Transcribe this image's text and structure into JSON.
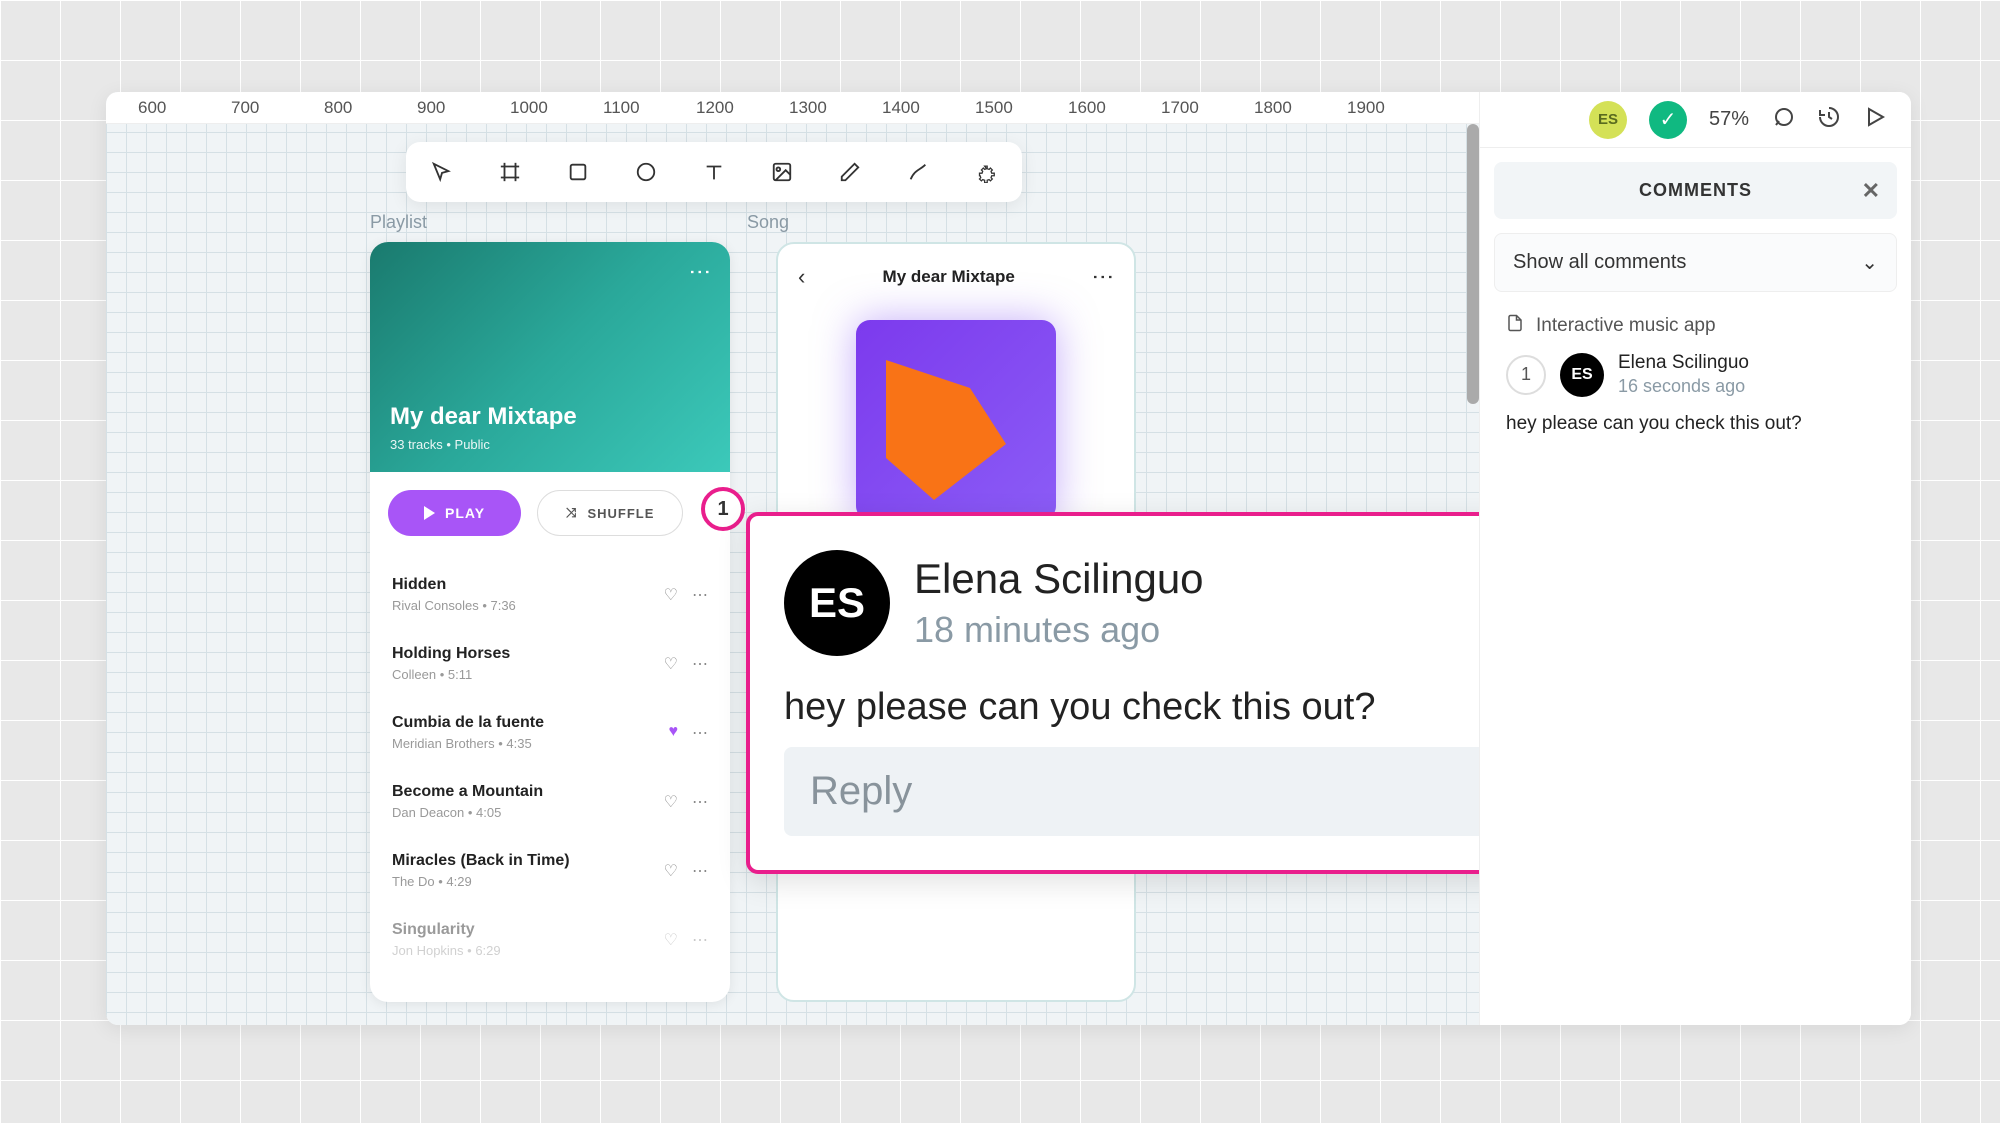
{
  "ruler": [
    "600",
    "700",
    "800",
    "900",
    "1000",
    "1100",
    "1200",
    "1300",
    "1400",
    "1500",
    "1600",
    "1700",
    "1800",
    "1900"
  ],
  "artboard": {
    "playlist_label": "Playlist",
    "song_label": "Song"
  },
  "playlist": {
    "title": "My dear Mixtape",
    "meta": "33 tracks • Public",
    "play_label": "PLAY",
    "shuffle_label": "SHUFFLE",
    "tracks": [
      {
        "title": "Hidden",
        "sub": "Rival Consoles • 7:36",
        "fav": false
      },
      {
        "title": "Holding Horses",
        "sub": "Colleen • 5:11",
        "fav": false
      },
      {
        "title": "Cumbia de la fuente",
        "sub": "Meridian Brothers • 4:35",
        "fav": true
      },
      {
        "title": "Become a Mountain",
        "sub": "Dan Deacon • 4:05",
        "fav": false
      },
      {
        "title": "Miracles (Back in Time)",
        "sub": "The Do • 4:29",
        "fav": false
      },
      {
        "title": "Singularity",
        "sub": "Jon Hopkins • 6:29",
        "fav": false,
        "faded": true
      }
    ]
  },
  "song": {
    "head_title": "My dear Mixtape"
  },
  "pin_number": "1",
  "popover": {
    "initials": "ES",
    "name": "Elena Scilinguo",
    "time": "18 minutes ago",
    "body": "hey please can you check this out?",
    "reply_placeholder": "Reply"
  },
  "topbar": {
    "user_initials": "ES",
    "zoom": "57%"
  },
  "comments_panel": {
    "title": "COMMENTS",
    "filter_label": "Show all comments",
    "file_label": "Interactive music app",
    "thread": {
      "pin": "1",
      "initials": "ES",
      "name": "Elena Scilinguo",
      "time": "16 seconds ago",
      "body": "hey please can you check this out?"
    }
  }
}
